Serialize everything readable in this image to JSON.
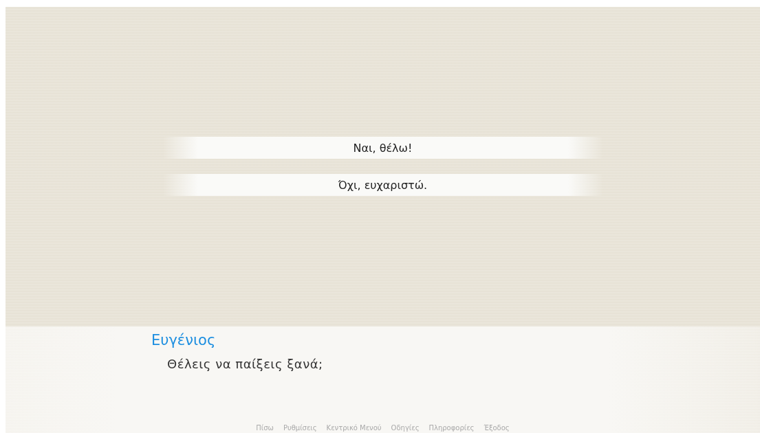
{
  "choices": [
    {
      "label": "Ναι, θέλω!"
    },
    {
      "label": "Όχι, ευχαριστώ."
    }
  ],
  "dialogue": {
    "speaker": "Ευγένιος",
    "text": "Θέλεις να παίξεις ξανά;"
  },
  "quick_menu": [
    "Πίσω",
    "Ρυθμίσεις",
    "Κεντρικό Μενού",
    "Οδηγίες",
    "Πληροφορίες",
    "Έξοδος"
  ]
}
